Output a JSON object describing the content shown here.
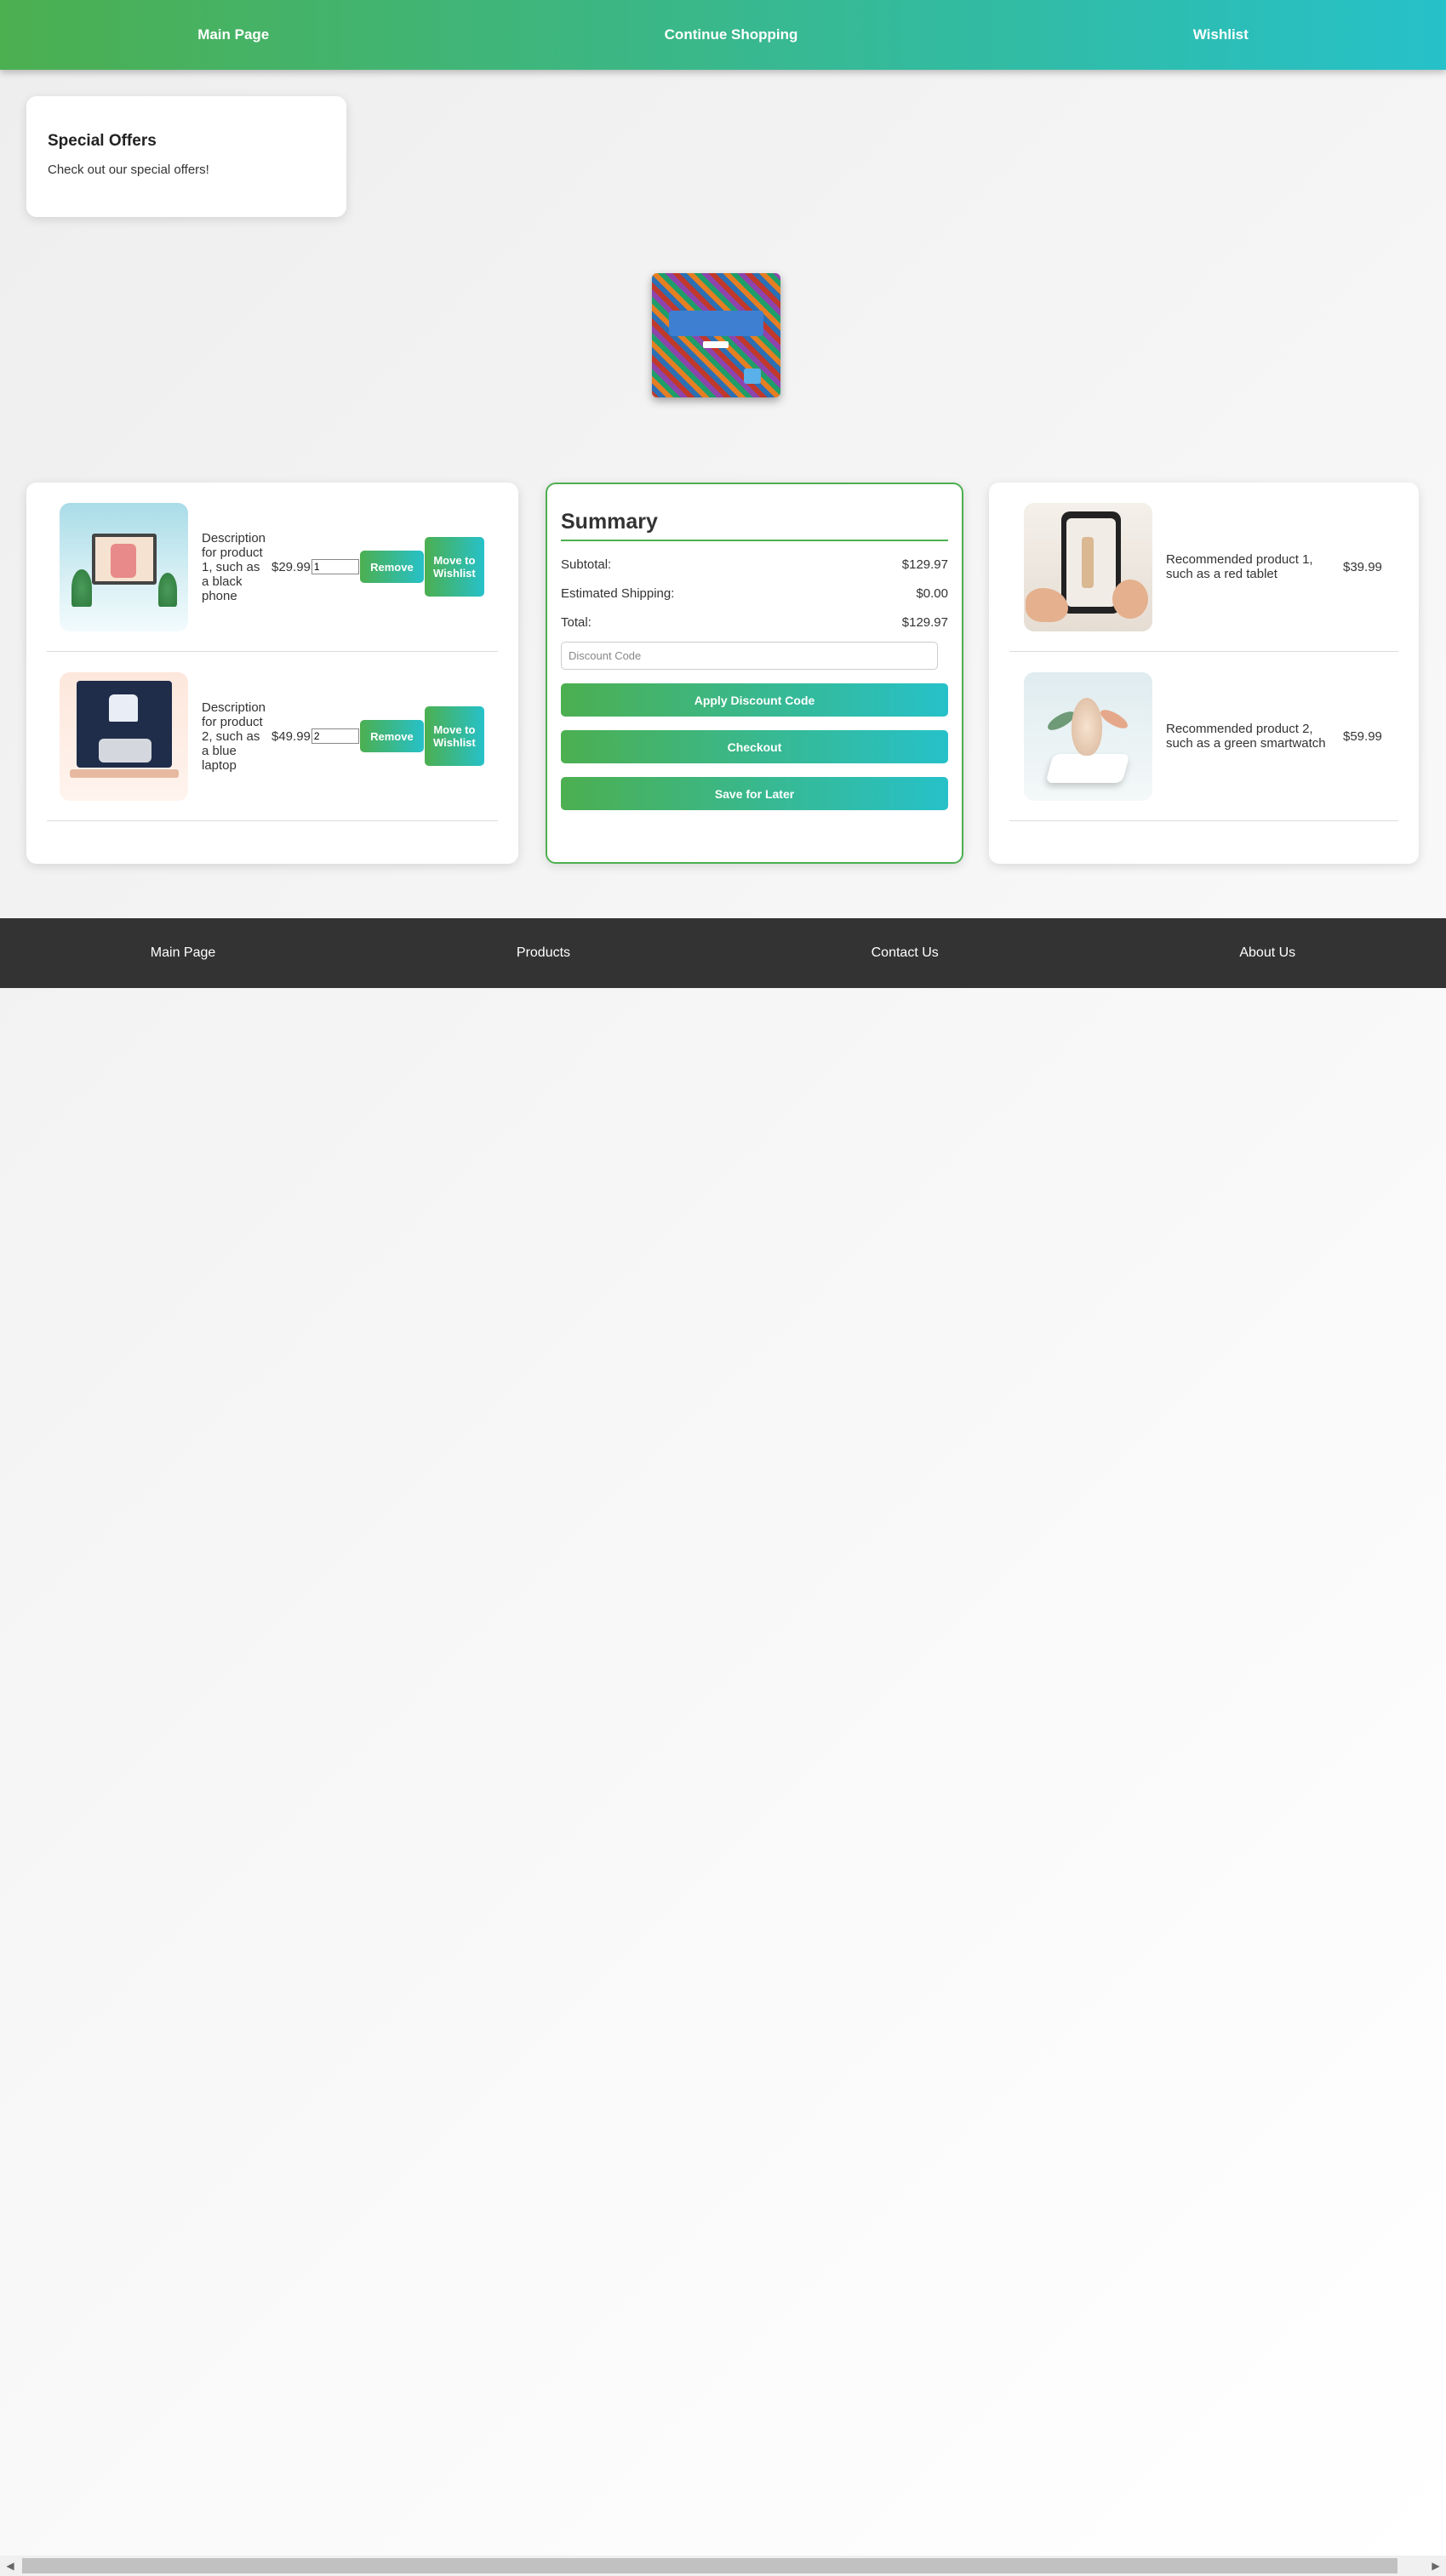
{
  "topnav": {
    "links": [
      "Main Page",
      "Continue Shopping",
      "Wishlist"
    ]
  },
  "offers": {
    "title": "Special Offers",
    "text": "Check out our special offers!"
  },
  "cart": {
    "items": [
      {
        "description": "Description for product 1, such as a black phone",
        "price": "$29.99",
        "quantity": "1",
        "remove_label": "Remove",
        "wishlist_label": "Move to Wishlist"
      },
      {
        "description": "Description for product 2, such as a blue laptop",
        "price": "$49.99",
        "quantity": "2",
        "remove_label": "Remove",
        "wishlist_label": "Move to Wishlist"
      }
    ]
  },
  "summary": {
    "title": "Summary",
    "rows": [
      {
        "label": "Subtotal:",
        "value": "$129.97"
      },
      {
        "label": "Estimated Shipping:",
        "value": "$0.00"
      },
      {
        "label": "Total:",
        "value": "$129.97"
      }
    ],
    "discount_placeholder": "Discount Code",
    "apply_label": "Apply Discount Code",
    "checkout_label": "Checkout",
    "save_label": "Save for Later"
  },
  "recommended": {
    "items": [
      {
        "description": "Recommended product 1, such as a red tablet",
        "price": "$39.99"
      },
      {
        "description": "Recommended product 2, such as a green smartwatch",
        "price": "$59.99"
      }
    ]
  },
  "footer": {
    "links": [
      "Main Page",
      "Products",
      "Contact Us",
      "About Us"
    ]
  },
  "colors": {
    "gradient_start": "#4caf50",
    "gradient_end": "#26c1c9",
    "footer_bg": "#333333"
  }
}
